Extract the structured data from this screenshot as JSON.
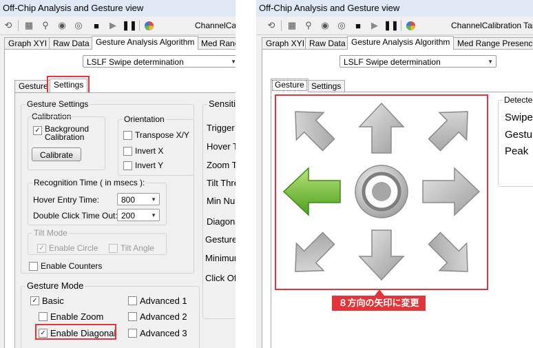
{
  "left": {
    "title": "Off-Chip Analysis and Gesture view",
    "toolbar_text": "ChannelCalib",
    "tabs": [
      "Graph XYI",
      "Raw Data",
      "Gesture Analysis Algorithm",
      "Med Rang"
    ],
    "algorithm": "LSLF Swipe determination",
    "subtabs": [
      "Gesture",
      "Settings"
    ],
    "gesture_settings": "Gesture Settings",
    "calibration": {
      "title": "Calibration",
      "background": "Background Calibration",
      "background_checked": "✓",
      "calibrate": "Calibrate"
    },
    "orientation": {
      "title": "Orientation",
      "items": [
        "Transpose X/Y",
        "Invert X",
        "Invert Y"
      ]
    },
    "recognition": {
      "title": "Recognition Time ( in msecs ):",
      "hover_label": "Hover Entry Time:",
      "hover_value": "800",
      "dbl_label": "Double Click Time Out:",
      "dbl_value": "200"
    },
    "tilt": {
      "title": "Tilt Mode",
      "enable_circle": "Enable Circle",
      "circle_checked": "✓",
      "tilt_angle": "Tilt Angle"
    },
    "enable_counters": "Enable Counters",
    "gesture_mode": {
      "title": "Gesture Mode",
      "basic": "Basic",
      "basic_checked": "✓",
      "enable_zoom": "Enable Zoom",
      "enable_diagonal": "Enable Diagonal",
      "diagonal_checked": "✓",
      "advanced": [
        "Advanced 1",
        "Advanced 2",
        "Advanced 3"
      ]
    },
    "sensitivity": {
      "title": "Sensitiv",
      "items": [
        "Trigger T",
        "Hover Th",
        "Zoom Th",
        "Tilt Thre",
        "Min Num",
        "Diagona",
        "Gesture",
        "Minimum",
        "Click Off"
      ]
    }
  },
  "right": {
    "title": "Off-Chip Analysis and Gesture view",
    "toolbar_text": "ChannelCalibration Tar",
    "tabs": [
      "Graph XYI",
      "Raw Data",
      "Gesture Analysis Algorithm",
      "Med Range Presence"
    ],
    "algorithm": "LSLF Swipe determination",
    "subtabs": [
      "Gesture",
      "Settings"
    ],
    "detected": {
      "title": "Detected",
      "items": [
        "Swipe",
        "Gestu",
        "Peak"
      ]
    },
    "callout": "８方向の矢印に変更",
    "arrows": [
      {
        "dir": "up-left-arrow-icon",
        "active": false
      },
      {
        "dir": "up-arrow-icon",
        "active": false
      },
      {
        "dir": "up-right-arrow-icon",
        "active": false
      },
      {
        "dir": "left-arrow-icon",
        "active": true
      },
      {
        "dir": "center-button-icon",
        "active": false
      },
      {
        "dir": "right-arrow-icon",
        "active": false
      },
      {
        "dir": "down-left-arrow-icon",
        "active": false
      },
      {
        "dir": "down-arrow-icon",
        "active": false
      },
      {
        "dir": "down-right-arrow-icon",
        "active": false
      }
    ]
  },
  "colors": {
    "highlight": "#e0353a",
    "active_arrow": "#6fbf2c",
    "inactive_arrow": "#b9b9b9",
    "callout_bg": "#e0353a"
  }
}
